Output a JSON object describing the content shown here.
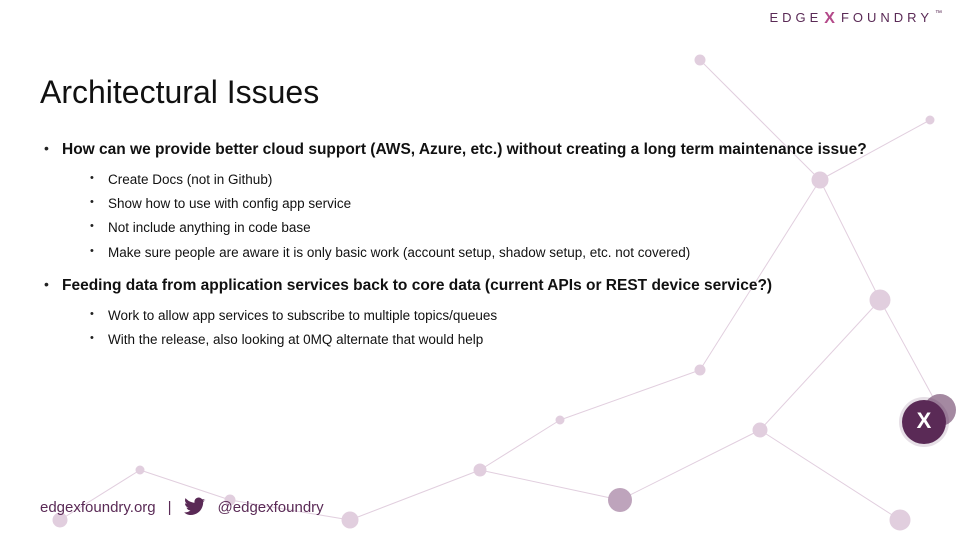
{
  "brand": {
    "left": "EDGE",
    "x": "X",
    "right": "FOUNDRY",
    "tm": "™"
  },
  "title": "Architectural Issues",
  "bullets": [
    {
      "text": "How can we provide better cloud support (AWS, Azure, etc.) without creating a long term maintenance issue?",
      "sub": [
        "Create Docs (not in Github)",
        "Show how to use with config app service",
        "Not include anything in code base",
        "Make sure people are aware it is only basic work (account setup, shadow setup, etc. not covered)"
      ]
    },
    {
      "text": "Feeding data from application services back to core data (current APIs or REST device service?)",
      "sub": [
        "Work to allow app services to subscribe to multiple topics/queues",
        "With the release, also looking at 0MQ alternate that would help"
      ]
    }
  ],
  "footer": {
    "site": "edgexfoundry.org",
    "sep": "|",
    "handle": "@edgexfoundry"
  },
  "badge": "X",
  "colors": {
    "brand": "#5a2a56",
    "accent": "#b44a8a"
  }
}
